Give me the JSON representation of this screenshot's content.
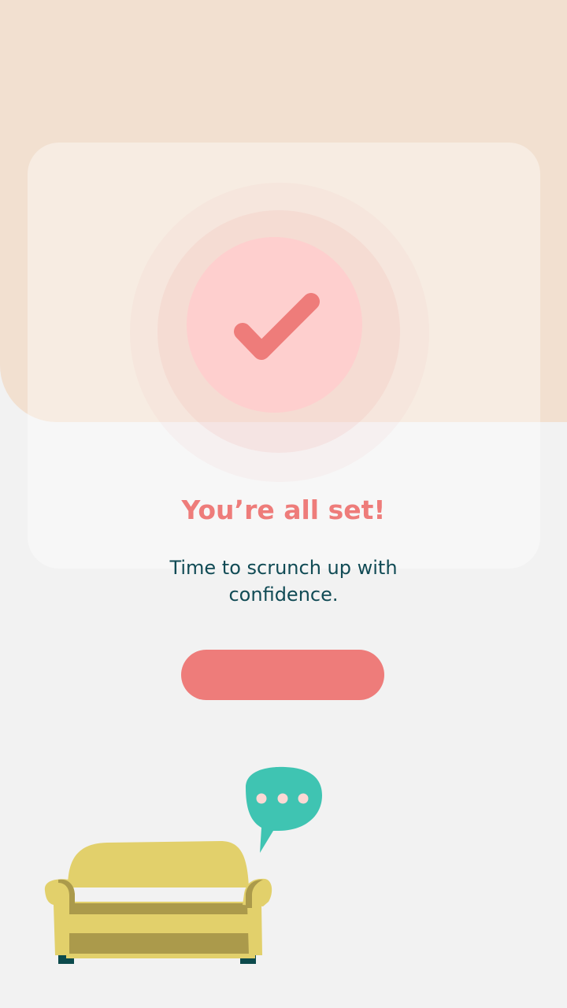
{
  "confirmation": {
    "title": "You’re all set!",
    "message": "Time to scrunch up with confidence.",
    "button_label": ""
  },
  "icons": {
    "status": "check-icon",
    "illustration": "sofa-icon",
    "speech": "chat-bubble-icon"
  },
  "colors": {
    "accent": "#ee7c7a",
    "top_background": "#f2e0d0",
    "background": "#f2f2f2",
    "text": "#114b55",
    "check_circle": "#fecfce",
    "sofa": "#e2d06b",
    "sofa_shadow": "#ab9a4b",
    "speech_bubble": "#3fc4b2"
  }
}
